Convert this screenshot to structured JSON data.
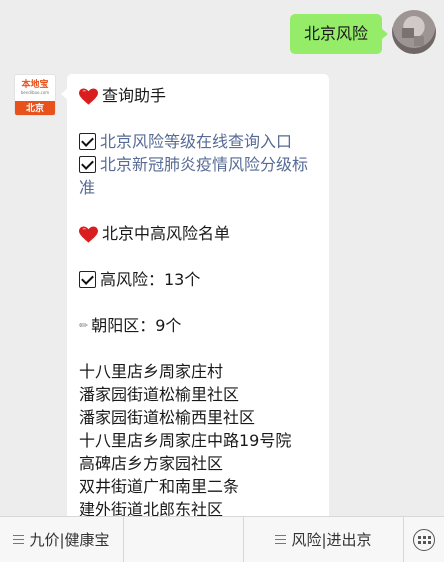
{
  "outgoing": {
    "text": "北京风险"
  },
  "bot": {
    "logo_name": "本地宝",
    "logo_url": "bendibao.com",
    "logo_city": "北京"
  },
  "message": {
    "assistant_title": "查询助手",
    "link1": "北京风险等级在线查询入口",
    "link2": "北京新冠肺炎疫情风险分级标准",
    "list_title": "北京中高风险名单",
    "high_risk": "高风险：13个",
    "district": "朝阳区：9个",
    "places": [
      "十八里店乡周家庄村",
      "潘家园街道松榆里社区",
      "潘家园街道松榆西里社区",
      "十八里店乡周家庄中路19号院",
      "高碑店乡方家园社区",
      "双井街道广和南里二条",
      "建外街道北郎东社区"
    ]
  },
  "menu": {
    "item1": "九价|健康宝",
    "item2": "",
    "item3": "风险|进出京"
  },
  "icons": [
    "heart-icon",
    "checkbox-icon",
    "pencil-icon",
    "menu-lines-icon",
    "keyboard-icon"
  ]
}
